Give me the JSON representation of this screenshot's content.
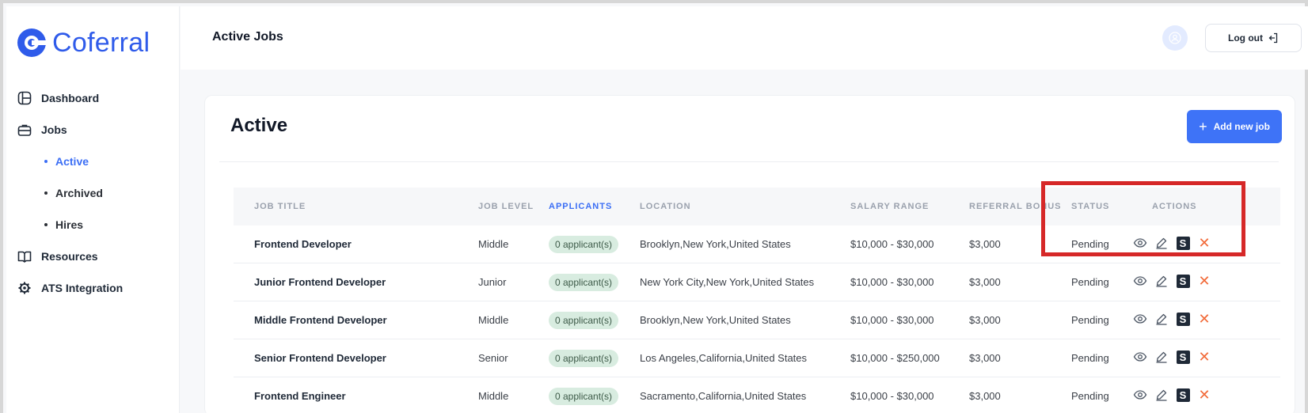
{
  "brand": {
    "name": "Coferral",
    "color": "#2f5bea"
  },
  "sidebar": {
    "items": [
      {
        "label": "Dashboard",
        "icon": "dashboard-icon"
      },
      {
        "label": "Jobs",
        "icon": "briefcase-icon"
      },
      {
        "label": "Resources",
        "icon": "book-icon"
      },
      {
        "label": "ATS Integration",
        "icon": "gear-sync-icon"
      }
    ],
    "jobs_sub": [
      {
        "label": "Active",
        "active": true
      },
      {
        "label": "Archived",
        "active": false
      },
      {
        "label": "Hires",
        "active": false
      }
    ]
  },
  "header": {
    "title": "Active Jobs",
    "logout_label": "Log out"
  },
  "card": {
    "title": "Active",
    "add_button": "Add new job"
  },
  "table": {
    "headers": {
      "job_title": "JOB TITLE",
      "job_level": "JOB LEVEL",
      "applicants": "APPLICANTS",
      "location": "LOCATION",
      "salary": "SALARY RANGE",
      "bonus": "REFERRAL BONUS",
      "status": "STATUS",
      "actions": "ACTIONS"
    },
    "rows": [
      {
        "title": "Frontend Developer",
        "level": "Middle",
        "applicants": "0 applicant(s)",
        "location": "Brooklyn,New York,United States",
        "salary": "$10,000 - $30,000",
        "bonus": "$3,000",
        "status": "Pending"
      },
      {
        "title": "Junior Frontend Developer",
        "level": "Junior",
        "applicants": "0 applicant(s)",
        "location": "New York City,New York,United States",
        "salary": "$10,000 - $30,000",
        "bonus": "$3,000",
        "status": "Pending"
      },
      {
        "title": "Middle Frontend Developer",
        "level": "Middle",
        "applicants": "0 applicant(s)",
        "location": "Brooklyn,New York,United States",
        "salary": "$10,000 - $30,000",
        "bonus": "$3,000",
        "status": "Pending"
      },
      {
        "title": "Senior Frontend Developer",
        "level": "Senior",
        "applicants": "0 applicant(s)",
        "location": "Los Angeles,California,United States",
        "salary": "$10,000 - $250,000",
        "bonus": "$3,000",
        "status": "Pending"
      },
      {
        "title": "Frontend Engineer",
        "level": "Middle",
        "applicants": "0 applicant(s)",
        "location": "Sacramento,California,United States",
        "salary": "$10,000 - $30,000",
        "bonus": "$3,000",
        "status": "Pending"
      }
    ],
    "action_icons": [
      "eye-icon",
      "pencil-icon",
      "s-square-icon",
      "close-icon"
    ]
  },
  "colors": {
    "accent": "#3e73f7",
    "badge_bg": "#d8ece0",
    "delete": "#f26b3a",
    "highlight": "#d62828"
  }
}
